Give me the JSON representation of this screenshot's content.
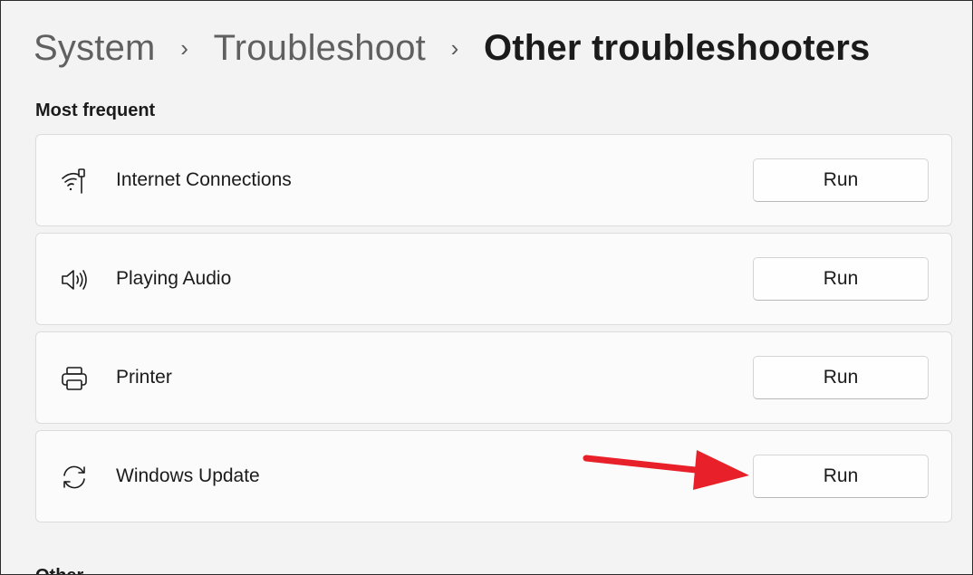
{
  "breadcrumb": {
    "items": [
      "System",
      "Troubleshoot",
      "Other troubleshooters"
    ],
    "separator": "›"
  },
  "section": {
    "title": "Most frequent"
  },
  "troubleshooters": [
    {
      "label": "Internet Connections",
      "icon": "wifi-ethernet-icon",
      "button": "Run"
    },
    {
      "label": "Playing Audio",
      "icon": "speaker-icon",
      "button": "Run"
    },
    {
      "label": "Printer",
      "icon": "printer-icon",
      "button": "Run"
    },
    {
      "label": "Windows Update",
      "icon": "sync-icon",
      "button": "Run"
    }
  ],
  "next_section": {
    "title": "Other"
  },
  "annotation": {
    "arrow_color": "#e8202a",
    "target": "Windows Update Run button"
  },
  "colors": {
    "background": "#f3f3f3",
    "card": "#fbfbfb",
    "text": "#1b1b1b",
    "breadcrumb_inactive": "#606060"
  }
}
